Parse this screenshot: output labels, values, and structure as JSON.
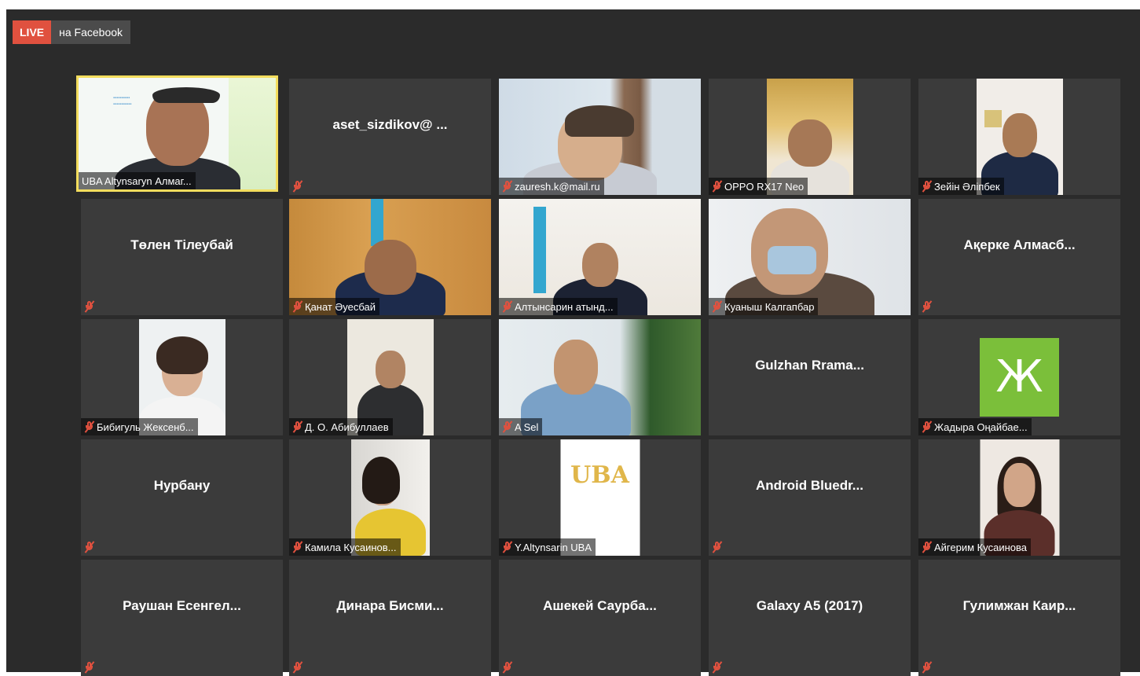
{
  "broadcast": {
    "live": "LIVE",
    "platform": "на Facebook"
  },
  "colors": {
    "active_border": "#f3dd5d",
    "muted_icon": "#e0513f",
    "avatar_bg": "#7bbf3a"
  },
  "participants": [
    {
      "center": "",
      "label": "UBA Altynsarуn Алмаг...",
      "video": true
    },
    {
      "center": "aset_sizdikov@ ...",
      "label": "",
      "video": false
    },
    {
      "center": "",
      "label": "zauresh.k@mail.ru",
      "video": true
    },
    {
      "center": "",
      "label": "OPPO RX17 Neo",
      "video": true
    },
    {
      "center": "",
      "label": "Зейін Әліпбек",
      "video": true
    },
    {
      "center": "Төлен Тілеубай",
      "label": "",
      "video": false
    },
    {
      "center": "",
      "label": "Қанат Әуесбай",
      "video": true
    },
    {
      "center": "",
      "label": "Алтынсарин атынд...",
      "video": true
    },
    {
      "center": "",
      "label": "Куаныш Калгапбар",
      "video": true
    },
    {
      "center": "Ақерке Алмасб...",
      "label": "",
      "video": false
    },
    {
      "center": "",
      "label": "Бибигуль Жексенб...",
      "video": true
    },
    {
      "center": "",
      "label": "Д. О. Абибуллаев",
      "video": true
    },
    {
      "center": "",
      "label": "A Sel",
      "video": true
    },
    {
      "center": "Gulzhan Rrama...",
      "label": "",
      "video": false
    },
    {
      "center": "",
      "label": "Жадыра Оңайбае...",
      "avatar": "Ж",
      "video": false
    },
    {
      "center": "Нурбану",
      "label": "",
      "video": false
    },
    {
      "center": "",
      "label": "Камила Кусаинов...",
      "video": true
    },
    {
      "center": "",
      "label": "Y.Altynsarin UBA",
      "logo": "UBA",
      "video": false
    },
    {
      "center": "Android Bluedr...",
      "label": "",
      "video": false
    },
    {
      "center": "",
      "label": "Айгерим Кусаинова",
      "video": true
    },
    {
      "center": "Раушан Есенгел...",
      "label": "",
      "video": false
    },
    {
      "center": "Динара Бисми...",
      "label": "",
      "video": false
    },
    {
      "center": "Ашекей Саурба...",
      "label": "",
      "video": false
    },
    {
      "center": "Galaxy A5 (2017)",
      "label": "",
      "video": false
    },
    {
      "center": "Гулимжан Каир...",
      "label": "",
      "video": false
    }
  ]
}
